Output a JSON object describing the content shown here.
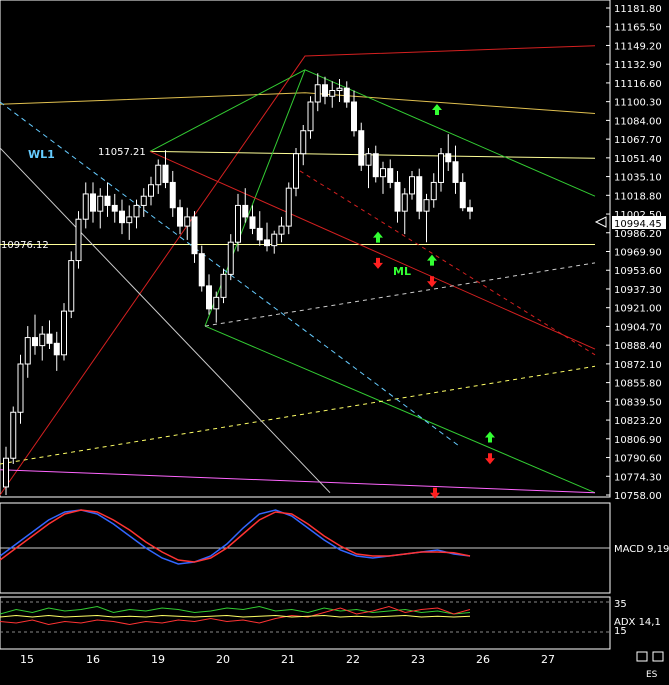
{
  "chart_data": [
    {
      "type": "candlestick",
      "title": "",
      "ylim": [
        10758.0,
        11181.8
      ],
      "y_ticks": [
        "11181.80",
        "11165.50",
        "11149.20",
        "11132.90",
        "11116.60",
        "11100.30",
        "11084.00",
        "11067.70",
        "11051.40",
        "11035.10",
        "11018.80",
        "11002.50",
        "10986.20",
        "10969.90",
        "10953.60",
        "10937.30",
        "10921.00",
        "10904.70",
        "10888.40",
        "10872.10",
        "10855.80",
        "10839.50",
        "10823.20",
        "10806.90",
        "10790.60",
        "10774.30",
        "10758.00"
      ],
      "current_price": "10994.45",
      "x_ticks": [
        "15",
        "16",
        "19",
        "20",
        "21",
        "22",
        "23",
        "26",
        "27"
      ],
      "annotations": [
        "WL1",
        "11057.21",
        "10976.12",
        "ML"
      ],
      "candles": [
        [
          10765,
          10800,
          10758,
          10790
        ],
        [
          10790,
          10835,
          10785,
          10830
        ],
        [
          10830,
          10880,
          10820,
          10872
        ],
        [
          10872,
          10905,
          10860,
          10895
        ],
        [
          10895,
          10915,
          10880,
          10888
        ],
        [
          10888,
          10905,
          10875,
          10898
        ],
        [
          10898,
          10910,
          10885,
          10890
        ],
        [
          10890,
          10900,
          10866,
          10880
        ],
        [
          10880,
          10925,
          10875,
          10918
        ],
        [
          10918,
          10970,
          10912,
          10962
        ],
        [
          10962,
          11005,
          10955,
          10998
        ],
        [
          10998,
          11030,
          10990,
          11020
        ],
        [
          11020,
          11030,
          10995,
          11005
        ],
        [
          11005,
          11025,
          10990,
          11018
        ],
        [
          11018,
          11030,
          11000,
          11010
        ],
        [
          11010,
          11020,
          10995,
          11005
        ],
        [
          11005,
          11015,
          10985,
          10995
        ],
        [
          10995,
          11010,
          10980,
          11000
        ],
        [
          11000,
          11015,
          10990,
          11010
        ],
        [
          11010,
          11025,
          11000,
          11018
        ],
        [
          11018,
          11035,
          11010,
          11028
        ],
        [
          11028,
          11050,
          11020,
          11045
        ],
        [
          11045,
          11058,
          11025,
          11030
        ],
        [
          11030,
          11040,
          11000,
          11008
        ],
        [
          11008,
          11015,
          10985,
          10992
        ],
        [
          10992,
          11008,
          10980,
          11000
        ],
        [
          11000,
          11005,
          10960,
          10968
        ],
        [
          10968,
          10975,
          10935,
          10940
        ],
        [
          10940,
          10950,
          10915,
          10920
        ],
        [
          10920,
          10935,
          10908,
          10930
        ],
        [
          10930,
          10955,
          10925,
          10950
        ],
        [
          10950,
          10985,
          10945,
          10978
        ],
        [
          10978,
          11020,
          10970,
          11010
        ],
        [
          11010,
          11025,
          10995,
          11000
        ],
        [
          11000,
          11010,
          10985,
          10990
        ],
        [
          10990,
          11005,
          10975,
          10980
        ],
        [
          10980,
          10995,
          10970,
          10975
        ],
        [
          10975,
          10988,
          10968,
          10985
        ],
        [
          10985,
          11000,
          10978,
          10992
        ],
        [
          10992,
          11030,
          10985,
          11025
        ],
        [
          11025,
          11060,
          11018,
          11055
        ],
        [
          11055,
          11080,
          11045,
          11075
        ],
        [
          11075,
          11105,
          11068,
          11100
        ],
        [
          11100,
          11125,
          11092,
          11115
        ],
        [
          11115,
          11122,
          11098,
          11105
        ],
        [
          11105,
          11118,
          11095,
          11110
        ],
        [
          11110,
          11120,
          11100,
          11112
        ],
        [
          11112,
          11118,
          11095,
          11100
        ],
        [
          11100,
          11110,
          11070,
          11075
        ],
        [
          11075,
          11082,
          11040,
          11045
        ],
        [
          11045,
          11060,
          11025,
          11055
        ],
        [
          11055,
          11062,
          11030,
          11035
        ],
        [
          11035,
          11048,
          11020,
          11042
        ],
        [
          11042,
          11050,
          11025,
          11030
        ],
        [
          11030,
          11040,
          10995,
          11005
        ],
        [
          11005,
          11025,
          10985,
          11020
        ],
        [
          11020,
          11040,
          11015,
          11035
        ],
        [
          11035,
          11042,
          10998,
          11005
        ],
        [
          11005,
          11020,
          10978,
          11015
        ],
        [
          11015,
          11038,
          11008,
          11030
        ],
        [
          11030,
          11060,
          11022,
          11055
        ],
        [
          11055,
          11072,
          11040,
          11048
        ],
        [
          11048,
          11062,
          11020,
          11030
        ],
        [
          11030,
          11038,
          11005,
          11008
        ],
        [
          11008,
          11015,
          10998,
          11005
        ]
      ],
      "lines": [
        {
          "color": "#d42020",
          "dash": "",
          "p": [
            [
              0,
              10758
            ],
            [
              305,
              11140
            ],
            [
              595,
              11149
            ]
          ]
        },
        {
          "color": "#e0c050",
          "dash": "",
          "p": [
            [
              0,
              11098
            ],
            [
              305,
              11108
            ],
            [
              595,
              11090
            ]
          ]
        },
        {
          "color": "#ffff99",
          "dash": "",
          "p": [
            [
              0,
              10976
            ],
            [
              595,
              10976
            ]
          ]
        },
        {
          "color": "#ffff99",
          "dash": "",
          "p": [
            [
              150,
              11057
            ],
            [
              595,
              11051
            ]
          ]
        },
        {
          "color": "#33cc33",
          "dash": "",
          "p": [
            [
              150,
              11057
            ],
            [
              305,
              11128
            ],
            [
              595,
              11018
            ]
          ]
        },
        {
          "color": "#33cc33",
          "dash": "",
          "p": [
            [
              305,
              11128
            ],
            [
              205,
              10905
            ]
          ]
        },
        {
          "color": "#d42020",
          "dash": "",
          "p": [
            [
              150,
              11057
            ],
            [
              595,
              10885
            ]
          ]
        },
        {
          "color": "#33cc33",
          "dash": "",
          "p": [
            [
              205,
              10905
            ],
            [
              595,
              10760
            ]
          ]
        },
        {
          "color": "#ff66ff",
          "dash": "",
          "p": [
            [
              0,
              10780
            ],
            [
              595,
              10760
            ]
          ]
        },
        {
          "color": "#cccccc",
          "dash": "4,4",
          "p": [
            [
              205,
              10905
            ],
            [
              595,
              10960
            ]
          ]
        },
        {
          "color": "#ffff66",
          "dash": "4,4",
          "p": [
            [
              0,
              10785
            ],
            [
              595,
              10870
            ]
          ]
        },
        {
          "color": "#66ccff",
          "dash": "5,4",
          "p": [
            [
              0,
              11100
            ],
            [
              460,
              10800
            ]
          ]
        },
        {
          "color": "#cccccc",
          "dash": "",
          "p": [
            [
              0,
              11060
            ],
            [
              330,
              10760
            ]
          ]
        },
        {
          "color": "#d42020",
          "dash": "4,4",
          "p": [
            [
              300,
              11040
            ],
            [
              595,
              10880
            ]
          ]
        }
      ],
      "arrows": [
        {
          "x": 437,
          "v": 11093,
          "dir": "up",
          "color": "#33ff33"
        },
        {
          "x": 378,
          "v": 10982,
          "dir": "up",
          "color": "#33ff33"
        },
        {
          "x": 378,
          "v": 10960,
          "dir": "down",
          "color": "#ff2020"
        },
        {
          "x": 432,
          "v": 10962,
          "dir": "up",
          "color": "#33ff33"
        },
        {
          "x": 432,
          "v": 10944,
          "dir": "down",
          "color": "#ff2020"
        },
        {
          "x": 490,
          "v": 10808,
          "dir": "up",
          "color": "#33ff33"
        },
        {
          "x": 490,
          "v": 10790,
          "dir": "down",
          "color": "#ff2020"
        },
        {
          "x": 435,
          "v": 10760,
          "dir": "down",
          "color": "#ff2020"
        }
      ]
    },
    {
      "type": "line",
      "label": "MACD 9,19",
      "series": [
        {
          "color": "#3366ff",
          "values": [
            -0.2,
            0.1,
            0.4,
            0.7,
            0.9,
            0.95,
            0.85,
            0.6,
            0.3,
            0.0,
            -0.25,
            -0.4,
            -0.35,
            -0.2,
            0.1,
            0.5,
            0.85,
            0.95,
            0.8,
            0.5,
            0.2,
            -0.05,
            -0.2,
            -0.25,
            -0.2,
            -0.15,
            -0.1,
            -0.05,
            -0.15,
            -0.2
          ]
        },
        {
          "color": "#ff3333",
          "values": [
            -0.3,
            0.0,
            0.3,
            0.6,
            0.85,
            0.95,
            0.9,
            0.7,
            0.45,
            0.15,
            -0.1,
            -0.3,
            -0.35,
            -0.25,
            0.0,
            0.35,
            0.7,
            0.9,
            0.85,
            0.6,
            0.3,
            0.05,
            -0.15,
            -0.2,
            -0.2,
            -0.15,
            -0.1,
            -0.1,
            -0.12,
            -0.2
          ]
        }
      ]
    },
    {
      "type": "line",
      "label": "ADX 14,1",
      "y_ticks": [
        "35",
        "15"
      ],
      "series": [
        {
          "color": "#33cc33",
          "values": [
            0.2,
            0.5,
            0.3,
            0.6,
            0.4,
            0.5,
            0.7,
            0.3,
            0.5,
            0.4,
            0.6,
            0.5,
            0.3,
            0.4,
            0.6,
            0.5,
            0.7,
            0.4,
            0.5,
            0.3,
            0.6,
            0.4,
            0.5,
            0.3,
            0.4,
            0.5,
            0.3,
            0.4,
            0.2,
            0.3
          ]
        },
        {
          "color": "#ff3333",
          "values": [
            -0.3,
            -0.4,
            -0.2,
            -0.5,
            -0.3,
            -0.4,
            -0.2,
            -0.3,
            -0.5,
            -0.3,
            -0.4,
            -0.2,
            -0.3,
            -0.1,
            -0.3,
            -0.2,
            -0.4,
            -0.1,
            0.1,
            0.0,
            0.3,
            0.6,
            0.2,
            0.4,
            0.7,
            0.3,
            0.5,
            0.6,
            0.2,
            0.5
          ]
        },
        {
          "color": "#ffff66",
          "values": [
            0.0,
            0.1,
            0.0,
            0.1,
            0.0,
            0.05,
            0.1,
            0.0,
            0.05,
            0.0,
            0.1,
            0.05,
            0.0,
            0.05,
            0.1,
            0.0,
            0.05,
            0.1,
            0.0,
            0.05,
            0.1,
            0.0,
            0.05,
            0.0,
            0.05,
            0.1,
            0.0,
            0.05,
            0.0,
            0.05
          ]
        }
      ]
    }
  ],
  "footer": {
    "symbol": "ES"
  },
  "colors": {
    "bg": "#000000",
    "text": "#ffffff",
    "frame": "#ffffff"
  }
}
